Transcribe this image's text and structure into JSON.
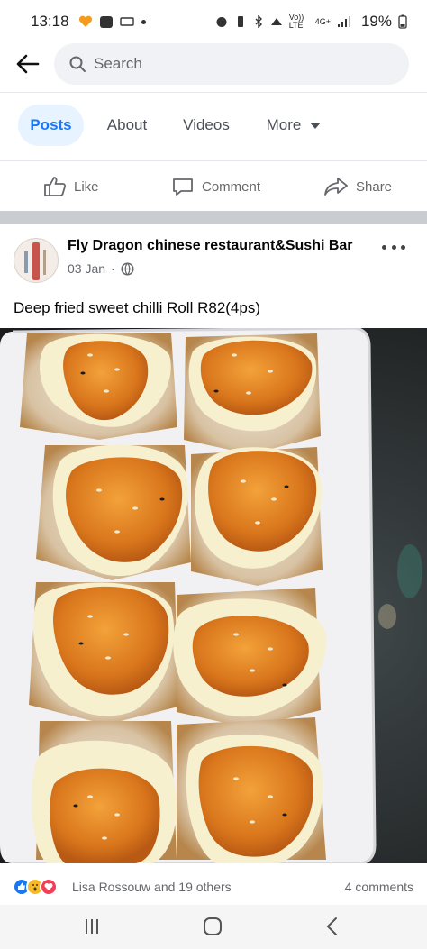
{
  "status_bar": {
    "time": "13:18",
    "network_label": "Vo)) LTE",
    "signal_label": "4G+",
    "battery": "19%"
  },
  "search": {
    "placeholder": "Search"
  },
  "tabs": [
    {
      "label": "Posts",
      "active": true
    },
    {
      "label": "About",
      "active": false
    },
    {
      "label": "Videos",
      "active": false
    },
    {
      "label": "More",
      "active": false
    }
  ],
  "actions": {
    "like": "Like",
    "comment": "Comment",
    "share": "Share"
  },
  "post": {
    "page_name": "Fly Dragon chinese restaurant&Sushi Bar",
    "date": "03 Jan",
    "caption": "Deep fried sweet chilli Roll  R82(4ps)"
  },
  "reactions": {
    "names": "Lisa Rossouw and 19 others",
    "comments": "4 comments"
  },
  "colors": {
    "accent": "#1877f2",
    "sauce": "#d9761c",
    "mayo": "#f7f0cf",
    "tray": "#f2f2f4"
  }
}
